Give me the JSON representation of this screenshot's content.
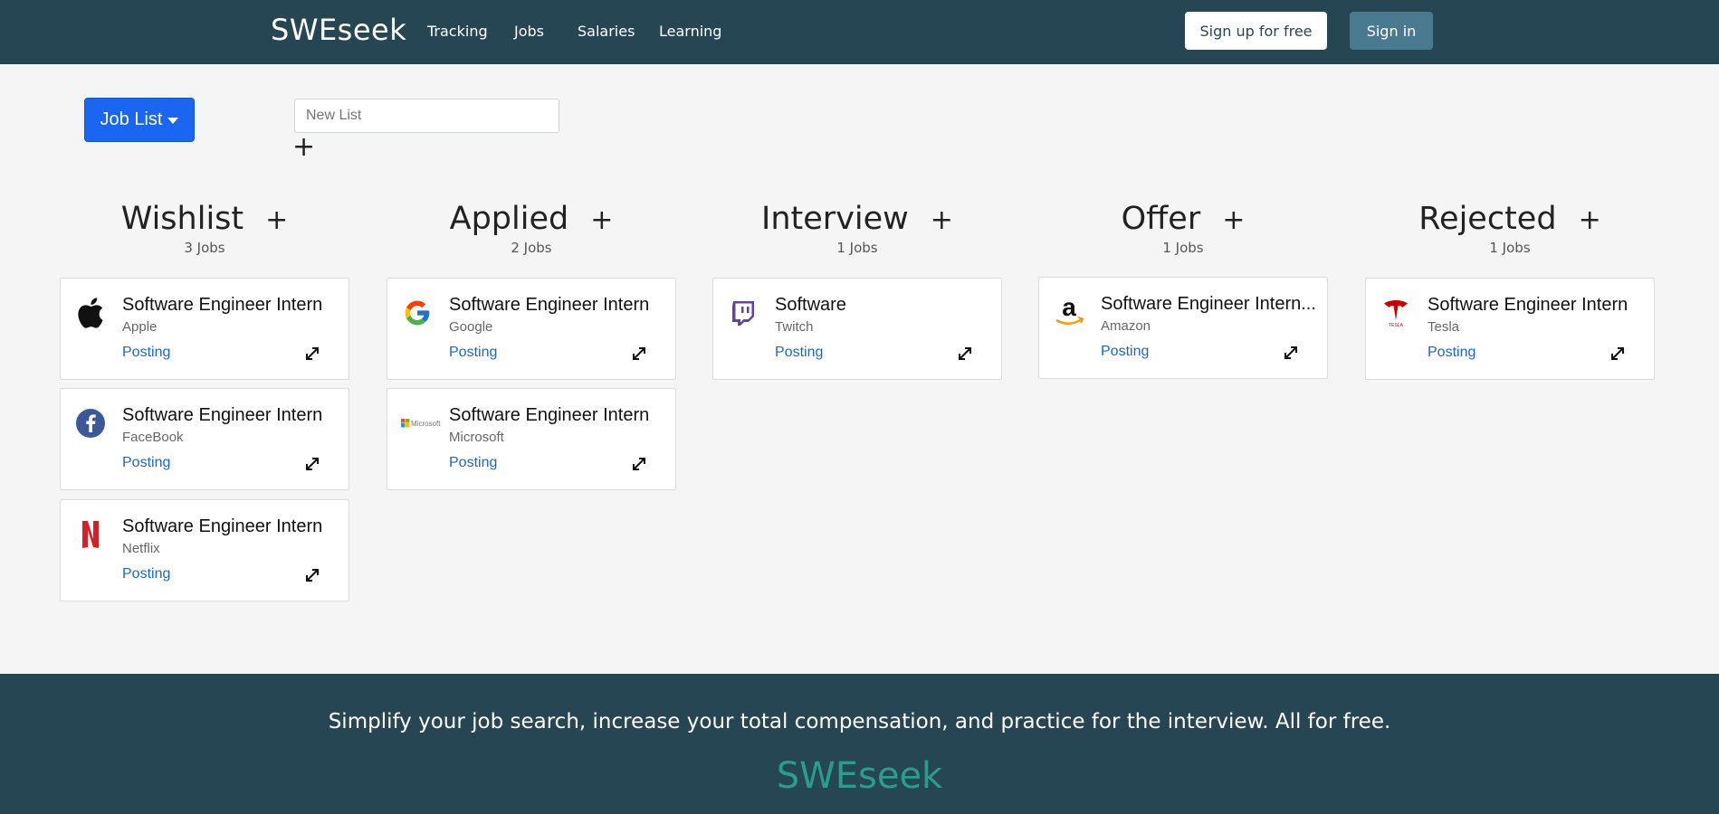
{
  "navbar": {
    "brand": "SWEseek",
    "links": [
      "Tracking",
      "Jobs",
      "Salaries",
      "Learning"
    ],
    "signup_label": "Sign up for free",
    "signin_label": "Sign in"
  },
  "toolbar": {
    "joblist_label": "Job List",
    "newlist_placeholder": "New List",
    "add_label": "+"
  },
  "columns": [
    {
      "title": "Wishlist",
      "plus": "+",
      "count": "3 Jobs",
      "cards": [
        {
          "title": "Software Engineer Intern",
          "company": "Apple",
          "link": "Posting",
          "logo_icon": "apple-logo-icon"
        },
        {
          "title": "Software Engineer Intern",
          "company": "FaceBook",
          "link": "Posting",
          "logo_icon": "facebook-logo-icon"
        },
        {
          "title": "Software Engineer Intern",
          "company": "Netflix",
          "link": "Posting",
          "logo_icon": "netflix-logo-icon"
        }
      ]
    },
    {
      "title": "Applied",
      "plus": "+",
      "count": "2 Jobs",
      "cards": [
        {
          "title": "Software Engineer Intern",
          "company": "Google",
          "link": "Posting",
          "logo_icon": "google-logo-icon"
        },
        {
          "title": "Software Engineer Intern",
          "company": "Microsoft",
          "link": "Posting",
          "logo_icon": "microsoft-logo-icon"
        }
      ]
    },
    {
      "title": "Interview",
      "plus": "+",
      "count": "1 Jobs",
      "cards": [
        {
          "title": "Software",
          "company": "Twitch",
          "link": "Posting",
          "logo_icon": "twitch-logo-icon"
        }
      ]
    },
    {
      "title": "Offer",
      "plus": "+",
      "count": "1 Jobs",
      "cards": [
        {
          "title": "Software Engineer Intern...",
          "company": "Amazon",
          "link": "Posting",
          "logo_icon": "amazon-logo-icon"
        }
      ]
    },
    {
      "title": "Rejected",
      "plus": "+",
      "count": "1 Jobs",
      "cards": [
        {
          "title": "Software Engineer Intern",
          "company": "Tesla",
          "link": "Posting",
          "logo_icon": "tesla-logo-icon"
        }
      ]
    }
  ],
  "microsoft_logo_text": "Microsoft",
  "tesla_logo_text": "TESLA",
  "footer": {
    "tagline": "Simplify your job search, increase your total compensation, and practice for the interview. All for free.",
    "brand": "SWEseek"
  },
  "colors": {
    "navbar_bg": "#264653",
    "page_bg": "#f5f5f5",
    "primary_button": "#1a66f0",
    "signin_button": "#4a7a90",
    "link": "#1a66d0",
    "footer_brand": "#2a9d8f"
  }
}
